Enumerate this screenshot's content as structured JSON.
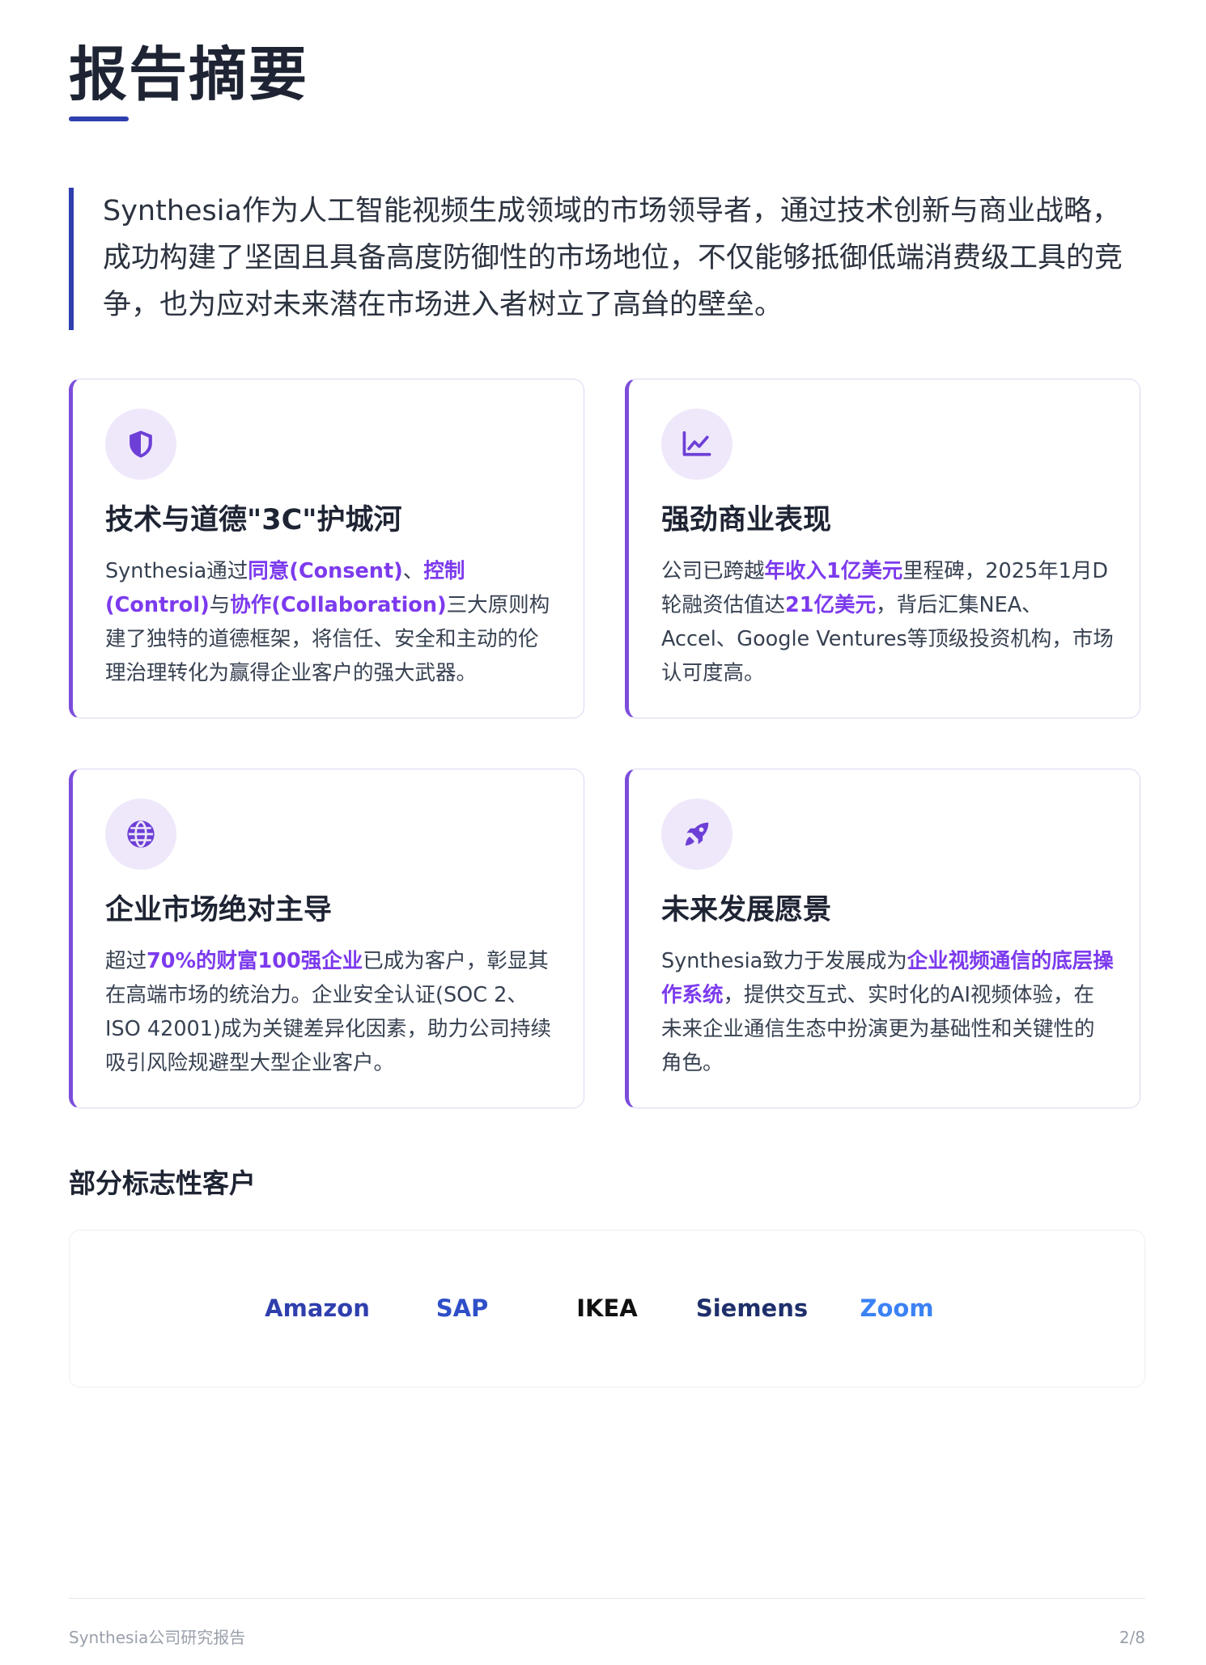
{
  "page_title": "报告摘要",
  "intro_text": "Synthesia作为人工智能视频生成领域的市场领导者，通过技术创新与商业战略，成功构建了坚固且具备高度防御性的市场地位，不仅能够抵御低端消费级工具的竞争，也为应对未来潜在市场进入者树立了高耸的壁垒。",
  "cards": [
    {
      "icon": "shield-icon",
      "title": "技术与道德\"3C\"护城河",
      "body": [
        {
          "t": "Synthesia通过"
        },
        {
          "t": "同意(Consent)",
          "hl": true
        },
        {
          "t": "、"
        },
        {
          "t": "控制(Control)",
          "hl": true
        },
        {
          "t": "与"
        },
        {
          "t": "协作(Collaboration)",
          "hl": true
        },
        {
          "t": "三大原则构建了独特的道德框架，将信任、安全和主动的伦理治理转化为赢得企业客户的强大武器。"
        }
      ]
    },
    {
      "icon": "chart-line-icon",
      "title": "强劲商业表现",
      "body": [
        {
          "t": "公司已跨越"
        },
        {
          "t": "年收入1亿美元",
          "hl": true
        },
        {
          "t": "里程碑，2025年1月D轮融资估值达"
        },
        {
          "t": "21亿美元",
          "hl": true
        },
        {
          "t": "，背后汇集NEA、Accel、Google Ventures等顶级投资机构，市场认可度高。"
        }
      ]
    },
    {
      "icon": "globe-icon",
      "title": "企业市场绝对主导",
      "body": [
        {
          "t": "超过"
        },
        {
          "t": "70%的财富100强企业",
          "hl": true
        },
        {
          "t": "已成为客户，彰显其在高端市场的统治力。企业安全认证(SOC 2、ISO 42001)成为关键差异化因素，助力公司持续吸引风险规避型大型企业客户。"
        }
      ]
    },
    {
      "icon": "rocket-icon",
      "title": "未来发展愿景",
      "body": [
        {
          "t": "Synthesia致力于发展成为"
        },
        {
          "t": "企业视频通信的底层操作系统",
          "hl": true
        },
        {
          "t": "，提供交互式、实时化的AI视频体验，在未来企业通信生态中扮演更为基础性和关键性的角色。"
        }
      ]
    }
  ],
  "clients": {
    "heading": "部分标志性客户",
    "logos": [
      {
        "name": "Amazon",
        "color": "#2f3fae"
      },
      {
        "name": "SAP",
        "color": "#2f4fc8"
      },
      {
        "name": "IKEA",
        "color": "#111111"
      },
      {
        "name": "Siemens",
        "color": "#1e2f6b"
      },
      {
        "name": "Zoom",
        "color": "#3b82f6"
      }
    ]
  },
  "footer": {
    "left": "Synthesia公司研究报告",
    "right": "2/8"
  },
  "colors": {
    "accent_blue": "#2f3fae",
    "accent_purple": "#7c3aed",
    "icon_bg": "#efe8fb"
  }
}
